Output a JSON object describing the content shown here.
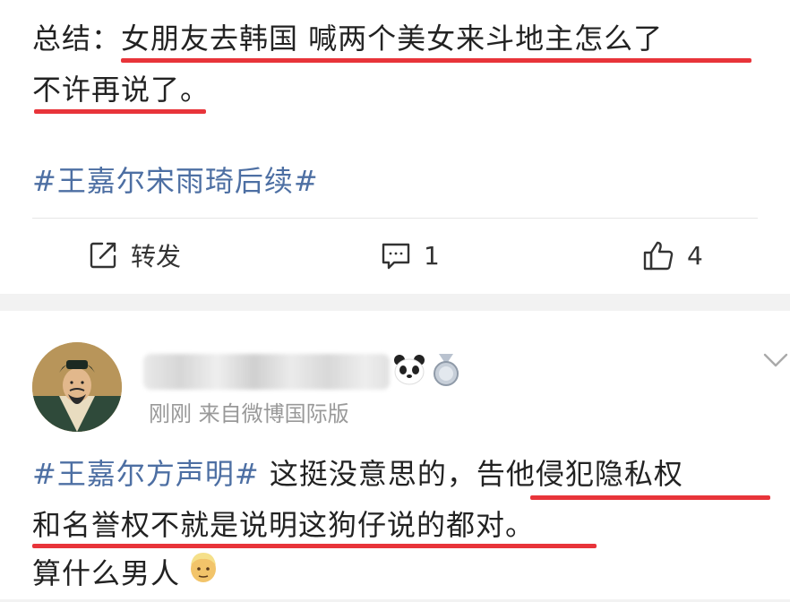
{
  "post1": {
    "summary_line1": "总结：女朋友去韩国 喊两个美女来斗地主怎么了",
    "summary_line2": "不许再说了。",
    "topic": "#王嘉尔宋雨琦后续#",
    "actions": {
      "repost_label": "转发",
      "comment_count": "1",
      "like_count": "4"
    }
  },
  "post2": {
    "meta": "刚刚  来自微博国际版",
    "topic": "#王嘉尔方声明#",
    "line1_rest": " 这挺没意思的，告他侵犯隐私权",
    "line2": "和名誉权不就是说明这狗仔说的都对。",
    "line3": "算什么男人"
  },
  "colors": {
    "topic": "#4d6fa3",
    "underline": "#e8343a",
    "meta": "#999999",
    "background": "#f2f2f2"
  },
  "icons": [
    "repost-icon",
    "comment-icon",
    "like-icon",
    "panda-icon",
    "medal-icon",
    "chevron-down-icon",
    "man-emoji-icon"
  ]
}
